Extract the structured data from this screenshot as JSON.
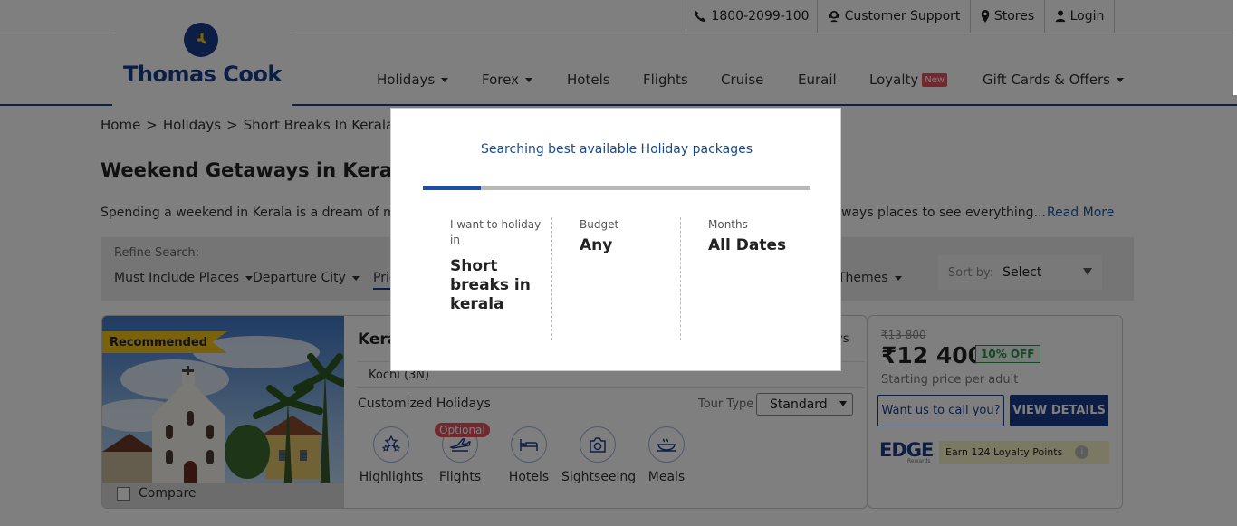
{
  "topbar": {
    "phone": "1800-2099-100",
    "support": "Customer Support",
    "stores": "Stores",
    "login": "Login"
  },
  "brand": {
    "name": "Thomas Cook"
  },
  "nav": {
    "holidays": "Holidays",
    "forex": "Forex",
    "hotels": "Hotels",
    "flights": "Flights",
    "cruise": "Cruise",
    "eurail": "Eurail",
    "loyalty": "Loyalty",
    "loyalty_badge": "New",
    "gift": "Gift Cards & Offers"
  },
  "breadcrumb": {
    "home": "Home",
    "sep1": ">",
    "holidays": "Holidays",
    "sep2": ">",
    "current": "Short Breaks In Kerala Tou"
  },
  "page": {
    "title": "Weekend Getaways in Kerala",
    "description": "Spending a weekend in Kerala is a dream of mar",
    "description_tail": "ways places to see everything...",
    "read_more": "Read More"
  },
  "refine": {
    "label": "Refine Search:",
    "must_include": "Must Include Places",
    "departure": "Departure City",
    "price_partial": "Pric",
    "themes": "Themes",
    "sort_label": "Sort by:",
    "sort_value": "Select"
  },
  "card": {
    "badge": "Recommended",
    "title_partial": "Kera",
    "title_tail": "ys",
    "route": "Kochi (3N)",
    "holiday_type": "Customized Holidays",
    "tour_type_label": "Tour Type",
    "tour_type_value": "Standard",
    "optional_badge": "Optional",
    "features": {
      "highlights": "Highlights",
      "flights": "Flights",
      "hotels": "Hotels",
      "sightseeing": "Sightseeing",
      "meals": "Meals"
    },
    "compare": "Compare"
  },
  "pricing": {
    "old_price": "₹13 800",
    "price": "₹12 400",
    "discount": "10% OFF",
    "starting": "Starting price per adult",
    "call_btn": "Want us to call you?",
    "view_btn": "VIEW DETAILS",
    "edge": "EDGE",
    "edge_sub": "Rewards",
    "loyalty_points": "Earn 124 Loyalty Points",
    "info": "i"
  },
  "modal": {
    "title": "Searching best available Holiday packages",
    "progress": 0.15,
    "want_label": "I want to holiday in",
    "want_value": "Short breaks in kerala",
    "budget_label": "Budget",
    "budget_value": "Any",
    "months_label": "Months",
    "months_value": "All Dates"
  },
  "colors": {
    "brand": "#1b3d8c",
    "progress_fill": "#1b4fa8",
    "badge_red": "#e8505b",
    "recommended": "#f5c518"
  }
}
